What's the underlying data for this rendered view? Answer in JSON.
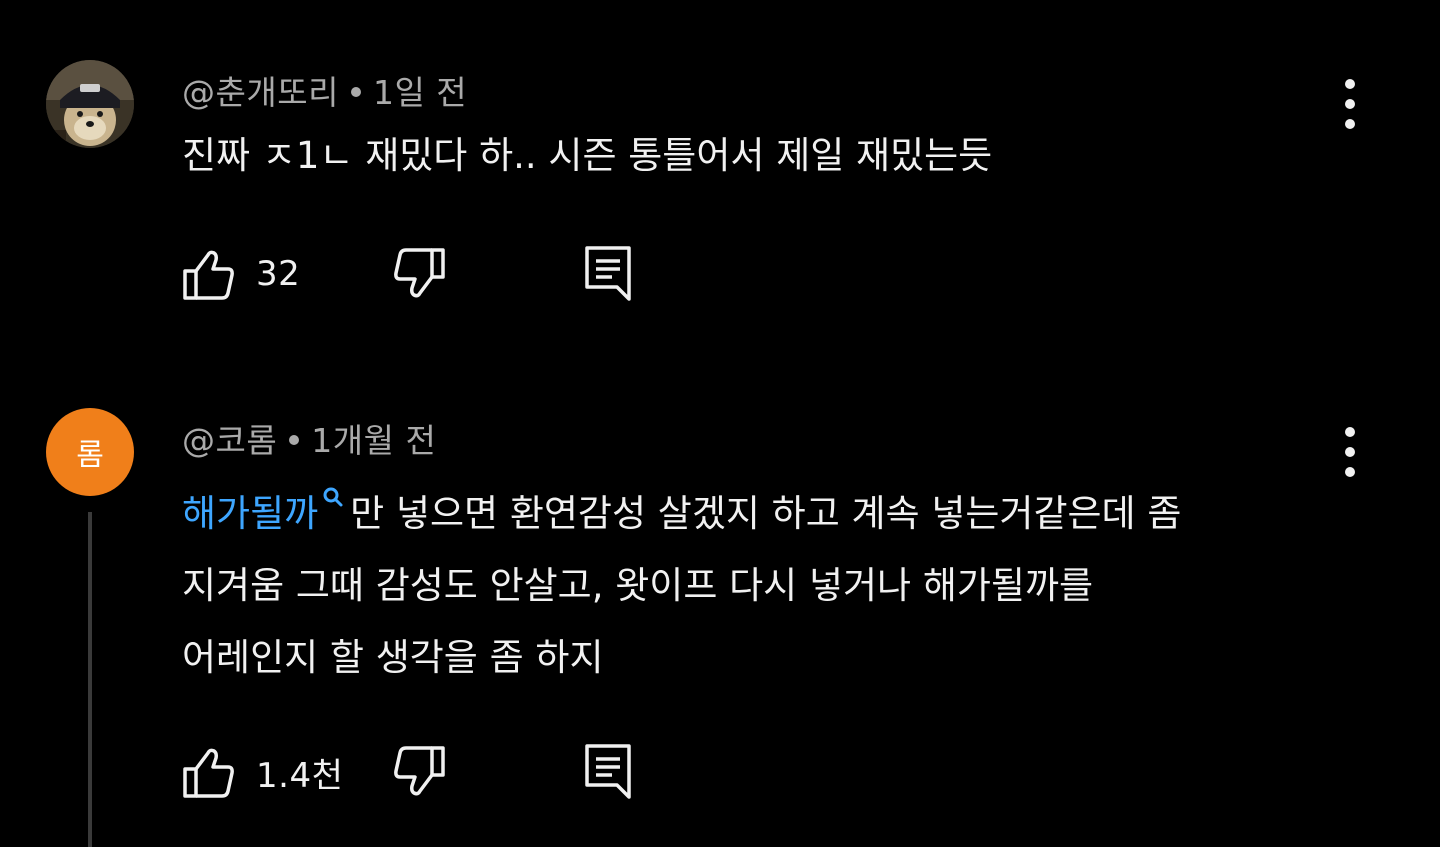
{
  "comments": [
    {
      "author": "@춘개또리",
      "time": "1일 전",
      "text": "진짜 ㅈ1ㄴ 재밌다 하.. 시즌 통틀어서 제일 재밌는듯",
      "likes": "32",
      "avatar_icon": "dog-photo-avatar"
    },
    {
      "author": "@코롬",
      "time": "1개월 전",
      "avatar_letter": "롬",
      "avatar_color": "#f07f1a",
      "link_text": "해가될까",
      "text_line1": "만 넣으면 환연감성 살겠지 하고 계속 넣는거같은데 좀",
      "text_line2": "지겨움 그때 감성도 안살고, 왓이프 다시 넣거나 해가될까를",
      "text_line3": "어레인지 할 생각을 좀 하지",
      "likes": "1.4천"
    }
  ],
  "colors": {
    "background": "#000000",
    "text": "#f1f1f1",
    "secondary": "#aaaaaa",
    "link": "#3ea6ff"
  }
}
